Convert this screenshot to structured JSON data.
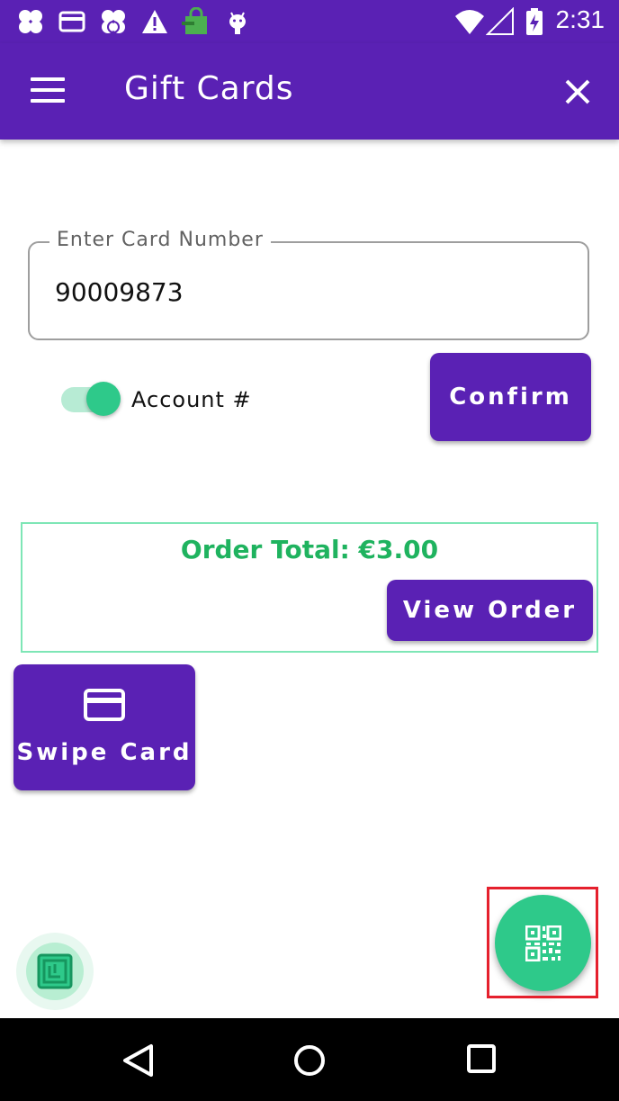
{
  "status_bar": {
    "time": "2:31",
    "icons": [
      "app-clover-icon",
      "card-icon",
      "app-clover-sync-icon",
      "warning-icon",
      "shopping-bag-icon",
      "android-icon",
      "wifi-icon",
      "signal-icon",
      "battery-icon"
    ]
  },
  "header": {
    "title": "Gift Cards",
    "menu_icon": "menu-icon",
    "close_icon": "close-icon"
  },
  "card_form": {
    "label": "Enter Card Number",
    "value": "90009873",
    "toggle_label": "Account #",
    "toggle_on": true,
    "confirm_label": "Confirm"
  },
  "order": {
    "total_text": "Order Total: €3.00",
    "view_order_label": "View Order"
  },
  "swipe": {
    "label": "Swipe Card",
    "icon": "credit-card-icon"
  },
  "fab": {
    "icon": "qr-code-icon"
  },
  "nfc": {
    "icon": "nfc-icon"
  },
  "navigation": {
    "back": "back-icon",
    "home": "home-icon",
    "recents": "recents-icon"
  },
  "colors": {
    "primary": "#5a21b4",
    "accent": "#2ec98a",
    "total_text": "#1fb35f",
    "highlight": "#e5202d"
  }
}
